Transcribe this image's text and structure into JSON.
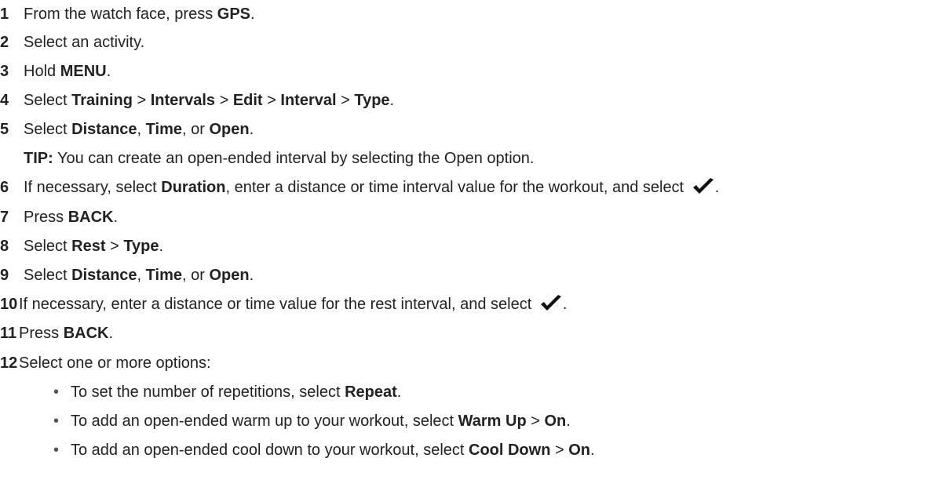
{
  "steps": [
    {
      "num": "1",
      "parts": [
        "From the watch face, press ",
        {
          "b": "GPS"
        },
        "."
      ]
    },
    {
      "num": "2",
      "parts": [
        "Select an activity."
      ]
    },
    {
      "num": "3",
      "parts": [
        "Hold ",
        {
          "b": "MENU"
        },
        "."
      ]
    },
    {
      "num": "4",
      "parts": [
        "Select ",
        {
          "b": "Training"
        },
        " > ",
        {
          "b": "Intervals"
        },
        " > ",
        {
          "b": "Edit"
        },
        " > ",
        {
          "b": "Interval"
        },
        " > ",
        {
          "b": "Type"
        },
        "."
      ]
    },
    {
      "num": "5",
      "parts": [
        "Select ",
        {
          "b": "Distance"
        },
        ", ",
        {
          "b": "Time"
        },
        ", or ",
        {
          "b": "Open"
        },
        "."
      ]
    },
    {
      "tip_label": "TIP:",
      "tip_text": " You can create an open-ended interval by selecting the Open option."
    },
    {
      "num": "6",
      "parts": [
        "If necessary, select ",
        {
          "b": "Duration"
        },
        ", enter a distance or time interval value for the workout, and select ",
        {
          "icon": "checkmark-icon"
        },
        "."
      ]
    },
    {
      "num": "7",
      "parts": [
        "Press ",
        {
          "b": "BACK"
        },
        "."
      ]
    },
    {
      "num": "8",
      "parts": [
        "Select ",
        {
          "b": "Rest"
        },
        " > ",
        {
          "b": "Type"
        },
        "."
      ]
    },
    {
      "num": "9",
      "parts": [
        "Select ",
        {
          "b": "Distance"
        },
        ", ",
        {
          "b": "Time"
        },
        ", or ",
        {
          "b": "Open"
        },
        "."
      ]
    },
    {
      "num": "10",
      "parts": [
        "If necessary, enter a distance or time value for the rest interval, and select ",
        {
          "icon": "checkmark-icon"
        },
        "."
      ]
    },
    {
      "num": "11",
      "parts": [
        "Press ",
        {
          "b": "BACK"
        },
        "."
      ]
    },
    {
      "num": "12",
      "parts": [
        "Select one or more options:"
      ]
    },
    {
      "bullet": "•",
      "parts": [
        "To set the number of repetitions, select ",
        {
          "b": "Repeat"
        },
        "."
      ]
    },
    {
      "bullet": "•",
      "parts": [
        "To add an open-ended warm up to your workout, select ",
        {
          "b": "Warm Up"
        },
        " > ",
        {
          "b": "On"
        },
        "."
      ]
    },
    {
      "bullet": "•",
      "parts": [
        "To add an open-ended cool down to your workout, select ",
        {
          "b": "Cool Down"
        },
        " > ",
        {
          "b": "On"
        },
        "."
      ]
    }
  ]
}
